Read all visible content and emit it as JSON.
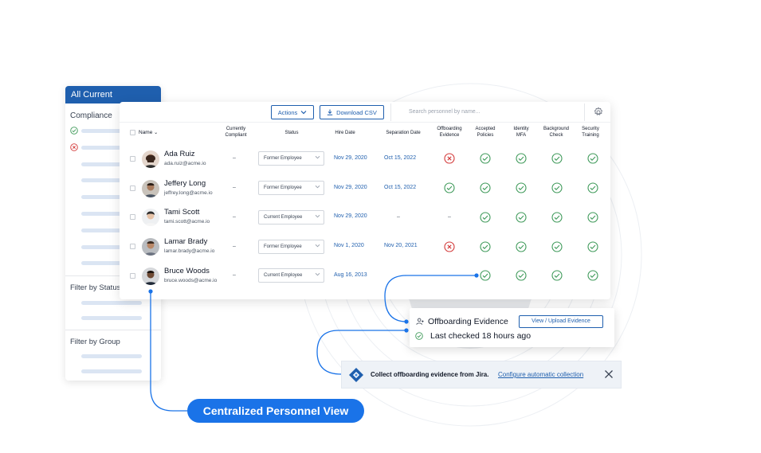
{
  "filter_panel": {
    "header": "All Current",
    "compliance_title": "Compliance",
    "filter_status_label": "Filter by Status",
    "filter_group_label": "Filter by Group"
  },
  "toolbar": {
    "actions_label": "Actions",
    "download_label": "Download CSV",
    "search_placeholder": "Search personnel by name..."
  },
  "columns": {
    "name": "Name",
    "compliant_1": "Currently",
    "compliant_2": "Compliant",
    "status": "Status",
    "hire_date": "Hire Date",
    "separation_date": "Separation Date",
    "offboarding_1": "Offboarding",
    "offboarding_2": "Evidence",
    "policies_1": "Accepted",
    "policies_2": "Policies",
    "mfa_1": "Identity",
    "mfa_2": "MFA",
    "background_1": "Background",
    "background_2": "Check",
    "training_1": "Security",
    "training_2": "Training"
  },
  "rows": [
    {
      "name": "Ada Ruiz",
      "email": "ada.ruiz@acme.io",
      "compliant": "–",
      "status": "Former Employee",
      "hire_date": "Nov 29, 2020",
      "separation_date": "Oct 15, 2022",
      "offboarding": "fail",
      "policies": "pass",
      "mfa": "pass",
      "background": "pass",
      "training": "pass"
    },
    {
      "name": "Jeffery Long",
      "email": "jeffrey.long@acme.io",
      "compliant": "–",
      "status": "Former Employee",
      "hire_date": "Nov 29, 2020",
      "separation_date": "Oct 15, 2022",
      "offboarding": "pass",
      "policies": "pass",
      "mfa": "pass",
      "background": "pass",
      "training": "pass"
    },
    {
      "name": "Tami Scott",
      "email": "tami.scott@acme.io",
      "compliant": "–",
      "status": "Current Employee",
      "hire_date": "Nov 29, 2020",
      "separation_date": "–",
      "offboarding": "–",
      "policies": "pass",
      "mfa": "pass",
      "background": "pass",
      "training": "pass"
    },
    {
      "name": "Lamar Brady",
      "email": "lamar.brady@acme.io",
      "compliant": "–",
      "status": "Former Employee",
      "hire_date": "Nov 1, 2020",
      "separation_date": "Nov 20, 2021",
      "offboarding": "fail",
      "policies": "pass",
      "mfa": "pass",
      "background": "pass",
      "training": "pass"
    },
    {
      "name": "Bruce Woods",
      "email": "bruce.woods@acme.io",
      "compliant": "–",
      "status": "Current Employee",
      "hire_date": "Aug 16, 2013",
      "separation_date": "",
      "offboarding": "",
      "policies": "pass",
      "mfa": "pass",
      "background": "pass",
      "training": "pass"
    }
  ],
  "evidence_popover": {
    "title": "Offboarding Evidence",
    "button_label": "View / Upload Evidence",
    "status_text": "Last checked 18 hours ago"
  },
  "jira_banner": {
    "text": "Collect offboarding evidence from Jira.",
    "link_label": "Configure automatic collection"
  },
  "callout_label": "Centralized Personnel View",
  "colors": {
    "brand": "#1f5fae",
    "pill": "#1a73e8",
    "pass": "#3f9a5a",
    "fail": "#d33a3a"
  }
}
